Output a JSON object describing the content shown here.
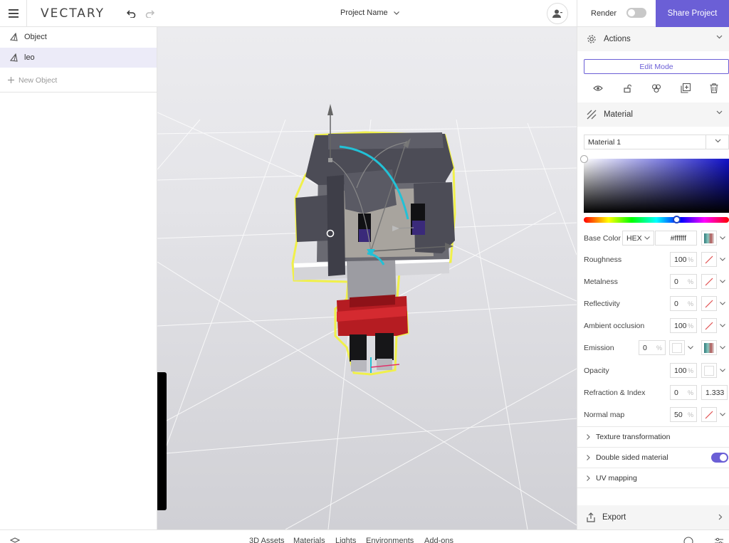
{
  "header": {
    "logo": "VECTARY",
    "project_name": "Project Name",
    "render_label": "Render",
    "render_enabled": false,
    "share_label": "Share Project"
  },
  "objects": {
    "items": [
      {
        "label": "Object",
        "selected": false
      },
      {
        "label": "leo",
        "selected": true
      }
    ],
    "new_object_label": "New Object"
  },
  "panel": {
    "actions": {
      "title": "Actions",
      "edit_mode_label": "Edit Mode",
      "icons": [
        "eye-icon",
        "unlock-icon",
        "group-icon",
        "duplicate-icon",
        "trash-icon"
      ]
    },
    "material": {
      "title": "Material",
      "selected_material": "Material 1",
      "base_color": {
        "label": "Base Color",
        "format": "HEX",
        "value": "#ffffff"
      },
      "properties": {
        "roughness": {
          "label": "Roughness",
          "value": "100",
          "unit": "%"
        },
        "metalness": {
          "label": "Metalness",
          "value": "0",
          "unit": "%"
        },
        "reflectivity": {
          "label": "Reflectivity",
          "value": "0",
          "unit": "%"
        },
        "ambient_occlusion": {
          "label": "Ambient occlusion",
          "value": "100",
          "unit": "%"
        },
        "emission": {
          "label": "Emission",
          "value": "0",
          "unit": "%"
        },
        "opacity": {
          "label": "Opacity",
          "value": "100",
          "unit": "%"
        },
        "refraction": {
          "label": "Refraction & Index",
          "value": "0",
          "unit": "%",
          "index": "1.333"
        },
        "normal_map": {
          "label": "Normal map",
          "value": "50",
          "unit": "%"
        }
      },
      "texture_transformation": "Texture transformation",
      "double_sided": {
        "label": "Double sided material",
        "enabled": true
      },
      "uv_mapping": "UV mapping"
    },
    "export_label": "Export"
  },
  "bottom_tabs": [
    "3D Assets",
    "Materials",
    "Lights",
    "Environments",
    "Add-ons"
  ],
  "colors": {
    "accent": "#6b5fd6",
    "selection_outline": "#f0f04a",
    "gizmo_cyan": "#22c1d6"
  }
}
